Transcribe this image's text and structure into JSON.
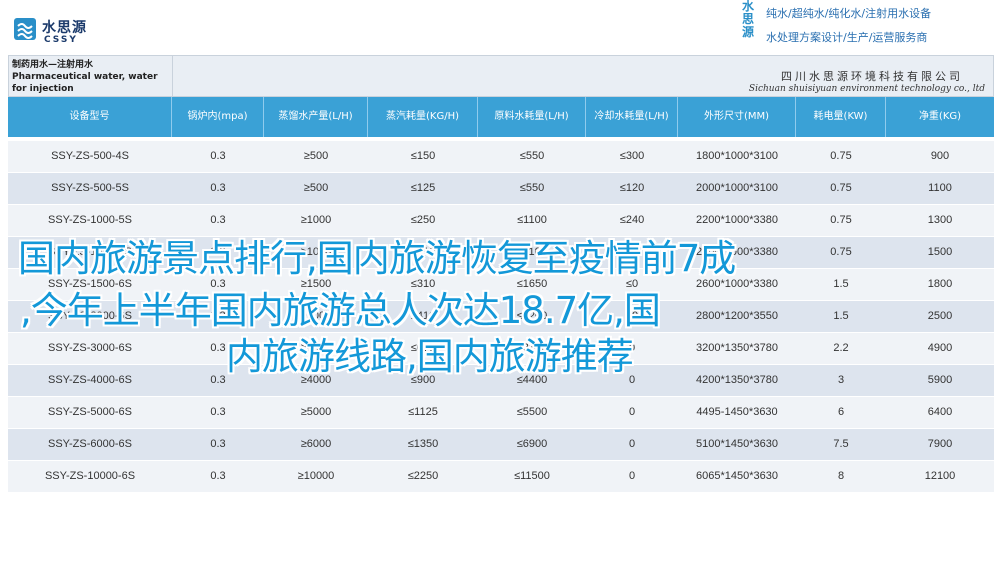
{
  "header": {
    "logo_cn": "水思源",
    "logo_en": "CSSY",
    "brand_vertical": "水思源",
    "brand_line1": "纯水/超纯水/纯化水/注射用水设备",
    "brand_line2": "水处理方案设计/生产/运营服务商"
  },
  "table": {
    "title_left": "制药用水—注射用水 Pharmaceutical water, water for injection",
    "company_cn": "四川水思源环境科技有限公司",
    "company_en": "Sichuan shuisiyuan environment technology co., ltd",
    "columns": [
      "设备型号",
      "锅炉内(mpa)",
      "蒸馏水产量(L/H)",
      "蒸汽耗量(KG/H)",
      "原料水耗量(L/H)",
      "冷却水耗量(L/H)",
      "外形尺寸(MM)",
      "耗电量(KW)",
      "净重(KG)"
    ],
    "rows": [
      [
        "SSY-ZS-500-4S",
        "0.3",
        "≥500",
        "≤150",
        "≤550",
        "≤300",
        "1800*1000*3100",
        "0.75",
        "900"
      ],
      [
        "SSY-ZS-500-5S",
        "0.3",
        "≥500",
        "≤125",
        "≤550",
        "≤120",
        "2000*1000*3100",
        "0.75",
        "1100"
      ],
      [
        "SSY-ZS-1000-5S",
        "0.3",
        "≥1000",
        "≤250",
        "≤1100",
        "≤240",
        "2200*1000*3380",
        "0.75",
        "1300"
      ],
      [
        "SSY-ZS-1000-6S",
        "0.3",
        "≥1000",
        "≤210",
        "≤1100",
        "≤0",
        "2400*1000*3380",
        "0.75",
        "1500"
      ],
      [
        "SSY-ZS-1500-6S",
        "0.3",
        "≥1500",
        "≤310",
        "≤1650",
        "≤0",
        "2600*1000*3380",
        "1.5",
        "1800"
      ],
      [
        "SSY-ZS-2000-6S",
        "0.3",
        "≥2000",
        "≤410",
        "≤2200",
        "≤0",
        "2800*1200*3550",
        "1.5",
        "2500"
      ],
      [
        "SSY-ZS-3000-6S",
        "0.3",
        "≥3000",
        "≤675",
        "≤3300",
        "0",
        "3200*1350*3780",
        "2.2",
        "4900"
      ],
      [
        "SSY-ZS-4000-6S",
        "0.3",
        "≥4000",
        "≤900",
        "≤4400",
        "0",
        "4200*1350*3780",
        "3",
        "5900"
      ],
      [
        "SSY-ZS-5000-6S",
        "0.3",
        "≥5000",
        "≤1125",
        "≤5500",
        "0",
        "4495-1450*3630",
        "6",
        "6400"
      ],
      [
        "SSY-ZS-6000-6S",
        "0.3",
        "≥6000",
        "≤1350",
        "≤6900",
        "0",
        "5100*1450*3630",
        "7.5",
        "7900"
      ],
      [
        "SSY-ZS-10000-6S",
        "0.3",
        "≥10000",
        "≤2250",
        "≤11500",
        "0",
        "6065*1450*3630",
        "8",
        "12100"
      ]
    ]
  },
  "overlay": {
    "line1": "国内旅游景点排行,国内旅游恢复至疫情前7成",
    "line2": ",今年上半年国内旅游总人次达18.7亿,国",
    "line3": "内旅游线路,国内旅游推荐"
  },
  "colors": {
    "header_blue": "#3aa1d6",
    "overlay_text": "#1398d8",
    "row_odd": "#f0f3f7",
    "row_even": "#dde4ee"
  }
}
